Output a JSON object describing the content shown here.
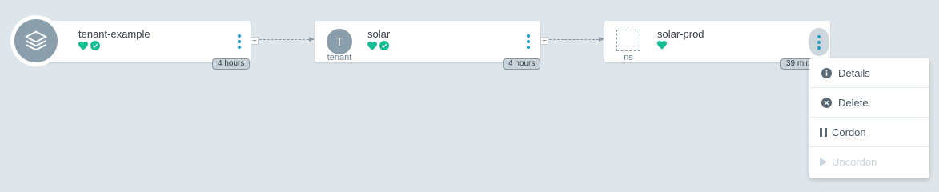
{
  "nodes": [
    {
      "title": "tenant-example",
      "age": "4 hours",
      "icon": "layers-icon",
      "health": "healthy",
      "sync": "synced"
    },
    {
      "title": "solar",
      "age": "4 hours",
      "icon_letter": "T",
      "kind": "tenant",
      "health": "healthy",
      "sync": "synced"
    },
    {
      "title": "solar-prod",
      "age": "39 min",
      "kind": "ns",
      "health": "healthy"
    }
  ],
  "menu": {
    "items": [
      {
        "label": "Details",
        "icon": "info-icon"
      },
      {
        "label": "Delete",
        "icon": "close-circle-icon"
      },
      {
        "label": "Cordon",
        "icon": "pause-icon"
      },
      {
        "label": "Uncordon",
        "icon": "play-icon",
        "disabled": true
      }
    ]
  },
  "colors": {
    "background": "#dee6eb",
    "healthy": "#18be94",
    "accent": "#1c9ec8",
    "icon_gray": "#8a9eac"
  }
}
